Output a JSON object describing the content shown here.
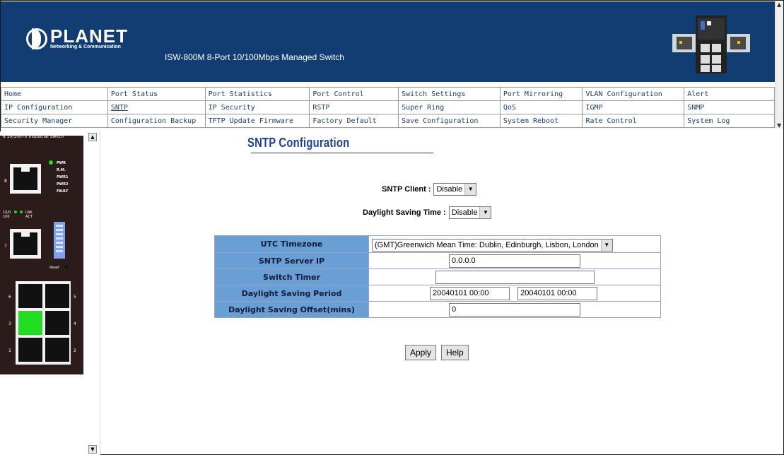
{
  "header": {
    "brand": "PLANET",
    "brand_tagline": "Networking & Communication",
    "product_title": "ISW-800M 8-Port 10/100Mbps Managed Switch"
  },
  "nav": {
    "rows": [
      [
        "Home",
        "Port Status",
        "Port Statistics",
        "Port Control",
        "Switch Settings",
        "Port Mirroring",
        "VLAN Configuration",
        "Alert"
      ],
      [
        "IP Configuration",
        "SNTP",
        "IP Security",
        "RSTP",
        "Super Ring",
        "QoS",
        "IGMP",
        "SNMP"
      ],
      [
        "Security Manager",
        "Configuration Backup",
        "TFTP Update Firmware",
        "Factory Default",
        "Save Configuration",
        "System Reboot",
        "Rate Control",
        "System Log"
      ]
    ],
    "active": "SNTP"
  },
  "side_panel": {
    "title": "8 10/100TX Industrial Switch",
    "led_labels": [
      "PWR",
      "R.M.",
      "PWR1",
      "PWR2",
      "FAULT"
    ],
    "port_labels": [
      "8",
      "7",
      "6",
      "5",
      "4",
      "3",
      "2",
      "1"
    ],
    "mini_labels": [
      "10/0 100",
      "LNK ACT"
    ],
    "reset_label": "Reset"
  },
  "main": {
    "title": "SNTP Configuration",
    "sntp_client": {
      "label": "SNTP Client :",
      "value": "Disable"
    },
    "daylight_saving": {
      "label": "Daylight Saving Time :",
      "value": "Disable"
    },
    "table": {
      "utc_label": "UTC Timezone",
      "utc_value": "(GMT)Greenwich Mean Time: Dublin, Edinburgh, Lisbon, London",
      "server_label": "SNTP Server IP",
      "server_value": "0.0.0.0",
      "timer_label": "Switch Timer",
      "timer_value": "",
      "period_label": "Daylight Saving Period",
      "period_start": "20040101 00:00",
      "period_end": "20040101 00:00",
      "offset_label": "Daylight Saving Offset(mins)",
      "offset_value": "0"
    },
    "apply_label": "Apply",
    "help_label": "Help"
  },
  "colors": {
    "header_bg": "#123d73",
    "table_label_bg": "#6a9fd6",
    "nav_text": "#1f3f73",
    "title_blue": "#1f3f9b",
    "port_active": "#22dd22"
  }
}
